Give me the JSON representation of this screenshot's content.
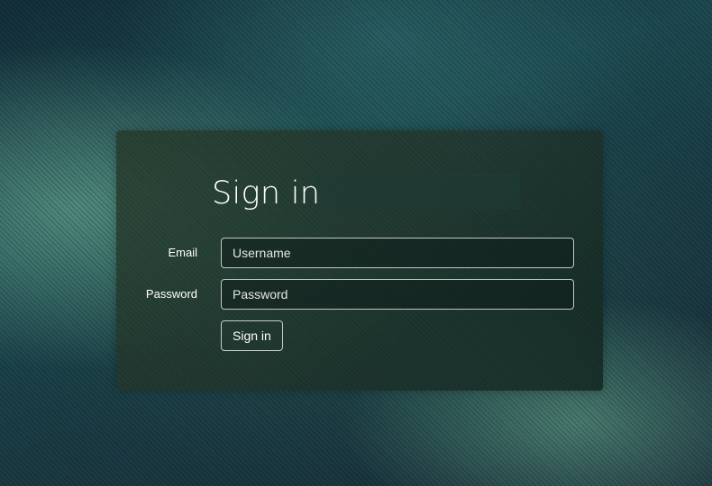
{
  "login": {
    "title": "Sign in",
    "email_label": "Email",
    "email_placeholder": "Username",
    "password_label": "Password",
    "password_placeholder": "Password",
    "submit_label": "Sign in"
  },
  "colors": {
    "background": "#1d4a52",
    "panel": "#2a4236",
    "text": "#ffffff",
    "border": "#dce6e1"
  }
}
